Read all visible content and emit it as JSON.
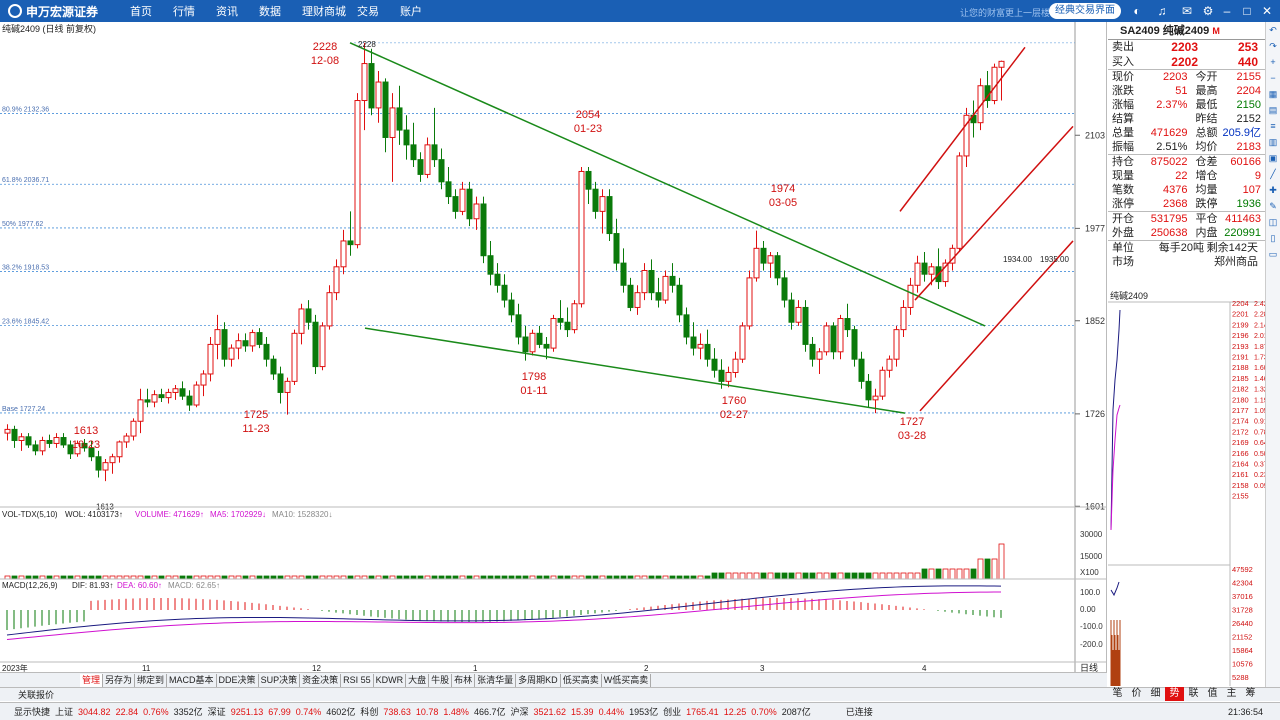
{
  "topbar": {
    "logo": "申万宏源证券",
    "nav": [
      "首页",
      "行情",
      "资讯",
      "数据",
      "理财商城",
      "交易",
      "账户"
    ],
    "slogan": "让您的财富更上一层楼",
    "classic": "经典交易界面"
  },
  "chart": {
    "title": "纯碱2409 (日线 前复权)",
    "fib": [
      "80.9% 2132.36",
      "61.8% 2036.71",
      "50% 1977.62",
      "38.2% 1918.53",
      "23.6% 1845.42",
      "Base 1727.24"
    ],
    "yticks": [
      "2103",
      "1977",
      "1852",
      "1726",
      "1601"
    ],
    "annotations": [
      {
        "v": "2228",
        "d": "12-08"
      },
      {
        "v": "2054",
        "d": "01-23"
      },
      {
        "v": "1974",
        "d": "03-05"
      },
      {
        "v": "1613",
        "d": "10-23"
      },
      {
        "v": "1725",
        "d": "11-23"
      },
      {
        "v": "1798",
        "d": "01-11"
      },
      {
        "v": "1760",
        "d": "02-27"
      },
      {
        "v": "1727",
        "d": "03-28"
      }
    ],
    "small_labels": [
      "2228",
      "1613",
      "1934.00",
      "1935.00"
    ],
    "vol_label": "VOL-TDX(5,10)",
    "vol_vals": [
      "WOL: 4103173↑",
      "VOLUME: 471629↑",
      "MA5: 1702929↓",
      "MA10: 1528320↓"
    ],
    "vol_ticks": [
      "30000",
      "15000",
      "X100"
    ],
    "macd_label": "MACD(12,26,9)",
    "macd_vals": [
      "DIF: 81.93↑",
      "DEA: 60.60↑",
      "MACD: 62.65↑"
    ],
    "macd_ticks": [
      "100.0",
      "0.00",
      "-100.0",
      "-200.0"
    ],
    "x_labels": [
      "2023年",
      "11",
      "12",
      "1",
      "2",
      "3",
      "4"
    ],
    "period": "日线"
  },
  "tabs": [
    "管理",
    "另存为",
    "绑定到",
    "MACD基本",
    "DDE决策",
    "SUP决策",
    "资金决策",
    "RSI 55",
    "KDWR",
    "大盘",
    "牛股",
    "布林",
    "张清华量",
    "多周期KD",
    "低买高卖",
    "W低买高卖"
  ],
  "quote": {
    "header": "SA2409 纯碱2409",
    "flag": "M",
    "sell": {
      "l": "卖出",
      "p": "2203",
      "q": "253"
    },
    "buy": {
      "l": "买入",
      "p": "2202",
      "q": "440"
    },
    "rows1": [
      [
        "现价",
        "2203",
        "今开",
        "2155"
      ],
      [
        "涨跌",
        "51",
        "最高",
        "2204"
      ],
      [
        "涨幅",
        "2.37%",
        "最低",
        "2150"
      ],
      [
        "结算",
        "",
        "昨结",
        "2152"
      ],
      [
        "总量",
        "471629",
        "总额",
        "205.9亿"
      ],
      [
        "振幅",
        "2.51%",
        "均价",
        "2183"
      ]
    ],
    "rows2": [
      [
        "持仓",
        "875022",
        "仓差",
        "60166"
      ],
      [
        "现量",
        "22",
        "增仓",
        "9"
      ],
      [
        "笔数",
        "4376",
        "均量",
        "107"
      ],
      [
        "涨停",
        "2368",
        "跌停",
        "1936"
      ]
    ],
    "rows3": [
      [
        "开仓",
        "531795",
        "平仓",
        "411463"
      ],
      [
        "外盘",
        "250638",
        "内盘",
        "220991"
      ]
    ],
    "unit_l": "单位",
    "unit_v": "每手20吨",
    "remain": "剩余142天",
    "market_l": "市场",
    "market_v": "郑州商品"
  },
  "mini": {
    "title": "纯碱2409",
    "prices": [
      "2204",
      "2201",
      "2199",
      "2196",
      "2193",
      "2191",
      "2188",
      "2185",
      "2182",
      "2180",
      "2177",
      "2174",
      "2172",
      "2169",
      "2166",
      "2164",
      "2161",
      "2158",
      "2155"
    ],
    "pcts": [
      "2.42",
      "2.28",
      "2.14",
      "2.01",
      "1.87",
      "1.73",
      "1.60",
      "1.46",
      "1.32",
      "1.19",
      "1.05",
      "0.91",
      "0.78",
      "0.64",
      "0.50",
      "0.37",
      "0.23",
      "0.09"
    ],
    "vols": [
      "47592",
      "42304",
      "37016",
      "31728",
      "26440",
      "21152",
      "15864",
      "10576",
      "5288"
    ]
  },
  "right_tabs": [
    "笔",
    "价",
    "细",
    "势",
    "联",
    "值",
    "主",
    "筹"
  ],
  "footer": "关联报价",
  "status": {
    "icon": "显示快捷",
    "items": [
      "上证",
      "3044.82",
      "22.84",
      "0.76%",
      "3352亿",
      "深证",
      "9251.13",
      "67.99",
      "0.74%",
      "4602亿",
      "科创",
      "738.63",
      "10.78",
      "1.48%",
      "466.7亿",
      "沪深",
      "3521.62",
      "15.39",
      "0.44%",
      "1953亿",
      "创业",
      "1765.41",
      "12.25",
      "0.70%",
      "2087亿"
    ],
    "conn": "已连接",
    "time": "21:36:54"
  },
  "chart_data": {
    "type": "candlestick",
    "series": [
      [
        1700,
        1712,
        1690,
        1705
      ],
      [
        1705,
        1710,
        1680,
        1690
      ],
      [
        1690,
        1700,
        1676,
        1695
      ],
      [
        1695,
        1700,
        1680,
        1684
      ],
      [
        1684,
        1690,
        1670,
        1676
      ],
      [
        1676,
        1695,
        1670,
        1690
      ],
      [
        1690,
        1698,
        1680,
        1686
      ],
      [
        1686,
        1700,
        1680,
        1694
      ],
      [
        1694,
        1700,
        1680,
        1684
      ],
      [
        1684,
        1690,
        1665,
        1672
      ],
      [
        1672,
        1690,
        1668,
        1686
      ],
      [
        1686,
        1692,
        1675,
        1680
      ],
      [
        1680,
        1690,
        1662,
        1668
      ],
      [
        1668,
        1676,
        1640,
        1650
      ],
      [
        1650,
        1665,
        1635,
        1660
      ],
      [
        1660,
        1672,
        1645,
        1668
      ],
      [
        1668,
        1690,
        1660,
        1688
      ],
      [
        1688,
        1700,
        1680,
        1696
      ],
      [
        1696,
        1720,
        1690,
        1716
      ],
      [
        1716,
        1760,
        1700,
        1745
      ],
      [
        1745,
        1760,
        1735,
        1742
      ],
      [
        1742,
        1758,
        1735,
        1752
      ],
      [
        1752,
        1760,
        1742,
        1748
      ],
      [
        1748,
        1760,
        1740,
        1755
      ],
      [
        1755,
        1765,
        1745,
        1760
      ],
      [
        1760,
        1770,
        1745,
        1750
      ],
      [
        1750,
        1758,
        1730,
        1738
      ],
      [
        1738,
        1770,
        1735,
        1765
      ],
      [
        1765,
        1785,
        1750,
        1780
      ],
      [
        1780,
        1830,
        1770,
        1820
      ],
      [
        1820,
        1860,
        1800,
        1840
      ],
      [
        1840,
        1850,
        1790,
        1800
      ],
      [
        1800,
        1820,
        1790,
        1815
      ],
      [
        1815,
        1835,
        1800,
        1825
      ],
      [
        1825,
        1835,
        1810,
        1818
      ],
      [
        1818,
        1840,
        1810,
        1836
      ],
      [
        1836,
        1842,
        1815,
        1820
      ],
      [
        1820,
        1830,
        1790,
        1800
      ],
      [
        1800,
        1805,
        1772,
        1780
      ],
      [
        1780,
        1790,
        1740,
        1755
      ],
      [
        1755,
        1775,
        1725,
        1770
      ],
      [
        1770,
        1840,
        1765,
        1835
      ],
      [
        1835,
        1875,
        1820,
        1868
      ],
      [
        1868,
        1880,
        1840,
        1850
      ],
      [
        1850,
        1860,
        1780,
        1790
      ],
      [
        1790,
        1850,
        1785,
        1845
      ],
      [
        1845,
        1900,
        1840,
        1890
      ],
      [
        1890,
        1935,
        1880,
        1925
      ],
      [
        1925,
        1975,
        1915,
        1960
      ],
      [
        1960,
        2000,
        1940,
        1955
      ],
      [
        1955,
        2160,
        1950,
        2150
      ],
      [
        2150,
        2228,
        2110,
        2200
      ],
      [
        2200,
        2220,
        2130,
        2140
      ],
      [
        2140,
        2190,
        2120,
        2175
      ],
      [
        2175,
        2180,
        2080,
        2100
      ],
      [
        2100,
        2160,
        2040,
        2140
      ],
      [
        2140,
        2170,
        2090,
        2110
      ],
      [
        2110,
        2130,
        2070,
        2090
      ],
      [
        2090,
        2120,
        2060,
        2070
      ],
      [
        2070,
        2080,
        2040,
        2050
      ],
      [
        2050,
        2100,
        2045,
        2090
      ],
      [
        2090,
        2140,
        2060,
        2070
      ],
      [
        2070,
        2085,
        2030,
        2040
      ],
      [
        2040,
        2060,
        2010,
        2020
      ],
      [
        2020,
        2030,
        1990,
        2000
      ],
      [
        2000,
        2040,
        1995,
        2030
      ],
      [
        2030,
        2040,
        1980,
        1990
      ],
      [
        1990,
        2020,
        1975,
        2010
      ],
      [
        2010,
        2020,
        1930,
        1940
      ],
      [
        1940,
        1960,
        1900,
        1915
      ],
      [
        1915,
        1930,
        1890,
        1900
      ],
      [
        1900,
        1915,
        1870,
        1880
      ],
      [
        1880,
        1890,
        1850,
        1860
      ],
      [
        1860,
        1875,
        1820,
        1830
      ],
      [
        1830,
        1845,
        1798,
        1810
      ],
      [
        1810,
        1840,
        1805,
        1835
      ],
      [
        1835,
        1845,
        1815,
        1820
      ],
      [
        1820,
        1830,
        1800,
        1815
      ],
      [
        1815,
        1860,
        1810,
        1855
      ],
      [
        1855,
        1880,
        1840,
        1850
      ],
      [
        1850,
        1870,
        1830,
        1840
      ],
      [
        1840,
        1880,
        1835,
        1875
      ],
      [
        1875,
        2060,
        1870,
        2054
      ],
      [
        2054,
        2060,
        2010,
        2030
      ],
      [
        2030,
        2040,
        1990,
        2000
      ],
      [
        2000,
        2030,
        1970,
        2020
      ],
      [
        2020,
        2030,
        1960,
        1970
      ],
      [
        1970,
        1990,
        1920,
        1930
      ],
      [
        1930,
        1950,
        1890,
        1900
      ],
      [
        1900,
        1910,
        1865,
        1870
      ],
      [
        1870,
        1900,
        1860,
        1890
      ],
      [
        1890,
        1930,
        1880,
        1920
      ],
      [
        1920,
        1935,
        1880,
        1890
      ],
      [
        1890,
        1910,
        1870,
        1880
      ],
      [
        1880,
        1920,
        1875,
        1912
      ],
      [
        1912,
        1930,
        1890,
        1900
      ],
      [
        1900,
        1910,
        1850,
        1860
      ],
      [
        1860,
        1870,
        1820,
        1830
      ],
      [
        1830,
        1850,
        1805,
        1815
      ],
      [
        1815,
        1835,
        1800,
        1820
      ],
      [
        1820,
        1840,
        1790,
        1800
      ],
      [
        1800,
        1815,
        1775,
        1785
      ],
      [
        1785,
        1800,
        1760,
        1770
      ],
      [
        1770,
        1790,
        1762,
        1782
      ],
      [
        1782,
        1810,
        1775,
        1800
      ],
      [
        1800,
        1850,
        1795,
        1845
      ],
      [
        1845,
        1920,
        1840,
        1910
      ],
      [
        1910,
        1974,
        1905,
        1950
      ],
      [
        1950,
        1960,
        1920,
        1930
      ],
      [
        1930,
        1945,
        1910,
        1940
      ],
      [
        1940,
        1945,
        1900,
        1910
      ],
      [
        1910,
        1920,
        1870,
        1880
      ],
      [
        1880,
        1890,
        1840,
        1850
      ],
      [
        1850,
        1880,
        1845,
        1870
      ],
      [
        1870,
        1880,
        1810,
        1820
      ],
      [
        1820,
        1830,
        1790,
        1800
      ],
      [
        1800,
        1815,
        1780,
        1810
      ],
      [
        1810,
        1850,
        1805,
        1845
      ],
      [
        1845,
        1850,
        1800,
        1810
      ],
      [
        1810,
        1860,
        1800,
        1855
      ],
      [
        1855,
        1875,
        1830,
        1840
      ],
      [
        1840,
        1845,
        1790,
        1800
      ],
      [
        1800,
        1810,
        1760,
        1770
      ],
      [
        1770,
        1780,
        1735,
        1745
      ],
      [
        1745,
        1760,
        1727,
        1750
      ],
      [
        1750,
        1790,
        1745,
        1785
      ],
      [
        1785,
        1805,
        1775,
        1800
      ],
      [
        1800,
        1845,
        1790,
        1840
      ],
      [
        1840,
        1880,
        1830,
        1870
      ],
      [
        1870,
        1910,
        1860,
        1900
      ],
      [
        1900,
        1940,
        1890,
        1930
      ],
      [
        1930,
        1945,
        1905,
        1915
      ],
      [
        1915,
        1930,
        1900,
        1925
      ],
      [
        1925,
        1950,
        1895,
        1905
      ],
      [
        1905,
        1935,
        1898,
        1930
      ],
      [
        1930,
        1955,
        1920,
        1950
      ],
      [
        1950,
        2080,
        1945,
        2075
      ],
      [
        2075,
        2140,
        2060,
        2130
      ],
      [
        2130,
        2150,
        2100,
        2120
      ],
      [
        2120,
        2180,
        2110,
        2170
      ],
      [
        2170,
        2190,
        2140,
        2150
      ],
      [
        2150,
        2200,
        2145,
        2195
      ],
      [
        2195,
        2204,
        2150,
        2203
      ]
    ],
    "ylim": [
      1600,
      2240
    ]
  }
}
